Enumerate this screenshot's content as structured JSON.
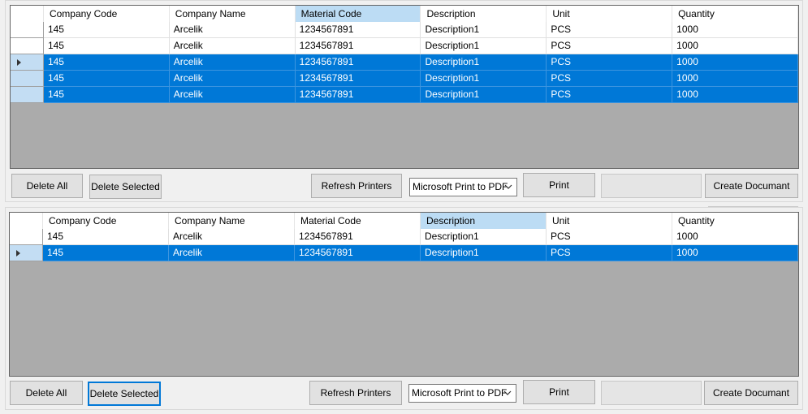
{
  "columns": [
    "Company Code",
    "Company Name",
    "Material Code",
    "Description",
    "Unit",
    "Quantity"
  ],
  "grid1": {
    "selected_column": "Material Code",
    "rows": [
      {
        "selected": false,
        "current": false,
        "cells": [
          "145",
          "Arcelik",
          "1234567891",
          "Description1",
          "PCS",
          "1000"
        ]
      },
      {
        "selected": false,
        "current": false,
        "cells": [
          "145",
          "Arcelik",
          "1234567891",
          "Description1",
          "PCS",
          "1000"
        ]
      },
      {
        "selected": true,
        "current": true,
        "cells": [
          "145",
          "Arcelik",
          "1234567891",
          "Description1",
          "PCS",
          "1000"
        ]
      },
      {
        "selected": true,
        "current": false,
        "cells": [
          "145",
          "Arcelik",
          "1234567891",
          "Description1",
          "PCS",
          "1000"
        ]
      },
      {
        "selected": true,
        "current": false,
        "cells": [
          "145",
          "Arcelik",
          "1234567891",
          "Description1",
          "PCS",
          "1000"
        ]
      }
    ]
  },
  "grid2": {
    "selected_column": "Description",
    "rows": [
      {
        "selected": false,
        "current": false,
        "cells": [
          "145",
          "Arcelik",
          "1234567891",
          "Description1",
          "PCS",
          "1000"
        ]
      },
      {
        "selected": true,
        "current": true,
        "cells": [
          "145",
          "Arcelik",
          "1234567891",
          "Description1",
          "PCS",
          "1000"
        ]
      }
    ]
  },
  "toolbar1": {
    "delete_all": "Delete All",
    "delete_selected": "Delete Selected",
    "refresh_printers": "Refresh Printers",
    "printer_selected": "Microsoft Print to PDF",
    "print": "Print",
    "blank": "",
    "create_document": "Create Documant"
  },
  "toolbar2": {
    "delete_all": "Delete All",
    "delete_selected": "Delete Selected",
    "refresh_printers": "Refresh Printers",
    "printer_selected": "Microsoft Print to PDF",
    "print": "Print",
    "blank": "",
    "create_document": "Create Documant"
  },
  "colors": {
    "selection": "#0078d7",
    "selected_header": "#bcdcf4",
    "grid_background": "#ababab"
  }
}
